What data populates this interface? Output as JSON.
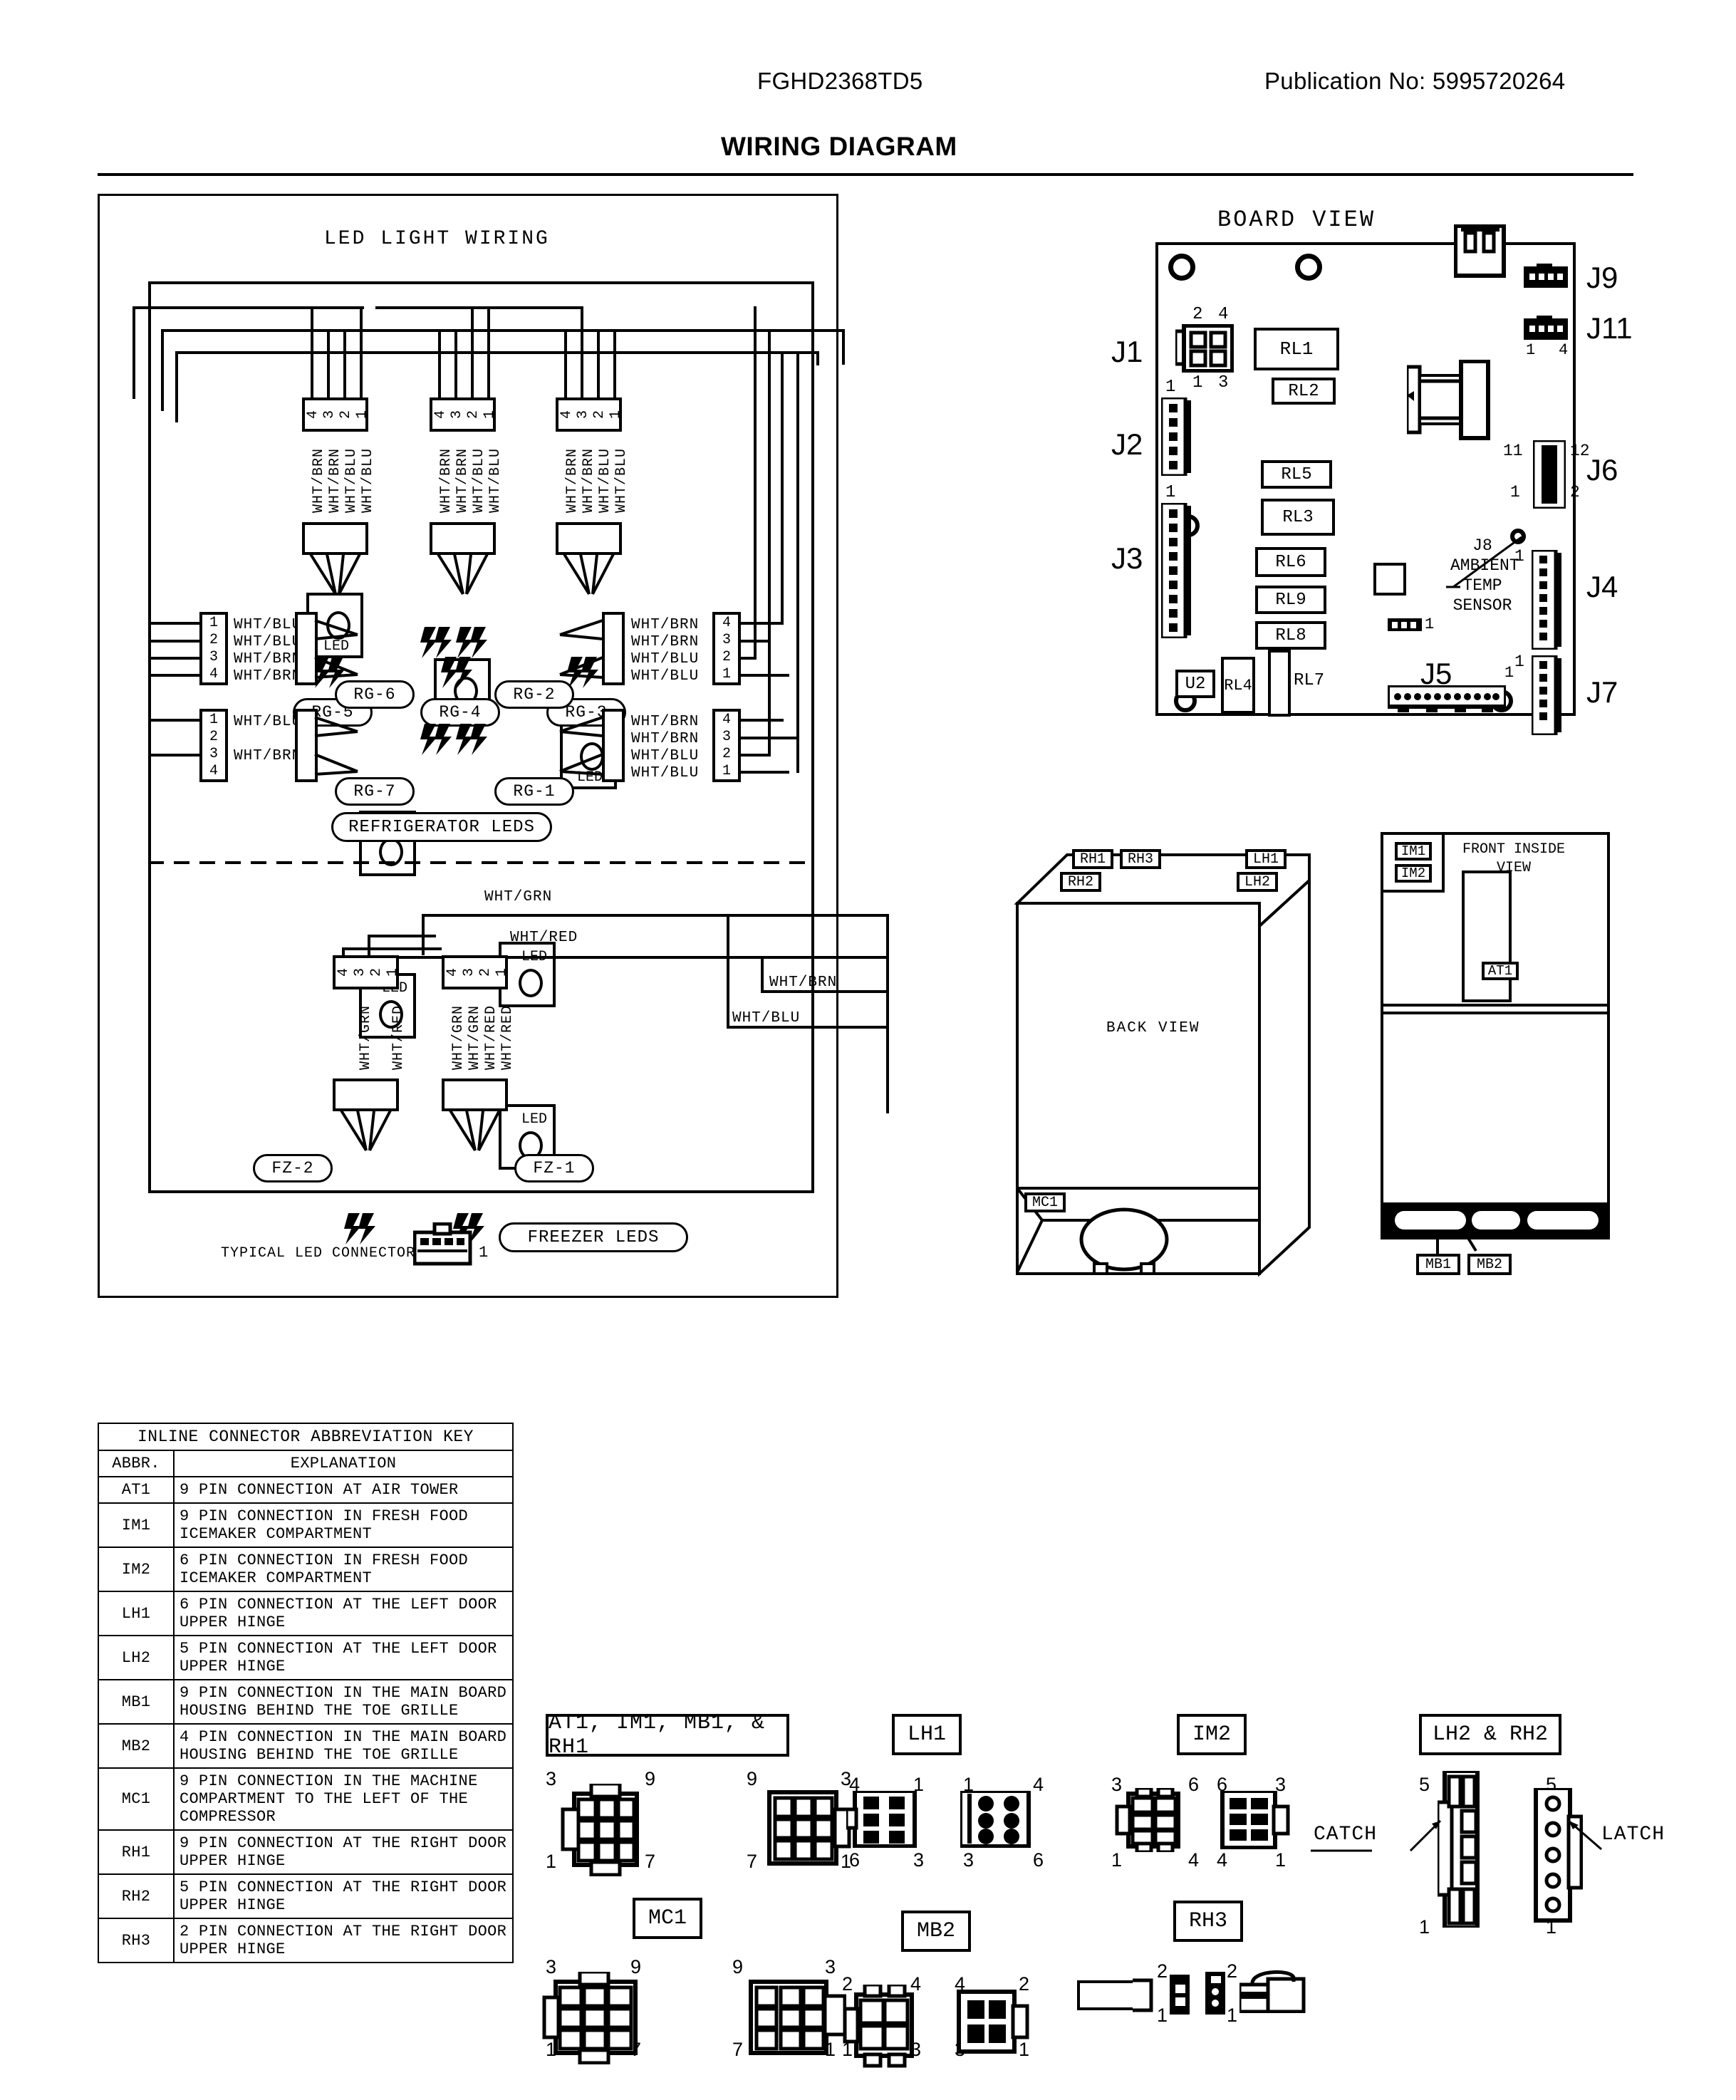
{
  "header": {
    "model": "FGHD2368TD5",
    "publication": "Publication No: 5995720264",
    "title": "WIRING DIAGRAM"
  },
  "led_panel": {
    "title": "LED LIGHT WIRING",
    "refrigerator_group_label": "REFRIGERATOR LEDS",
    "freezer_group_label": "FREEZER LEDS",
    "typical_connector_label": "TYPICAL LED CONNECTOR",
    "typical_connector_pin": "1",
    "top_row": [
      {
        "id": "RG-5",
        "pins": [
          "4",
          "3",
          "2",
          "1"
        ],
        "wires": [
          "WHT/BRN",
          "WHT/BRN",
          "WHT/BLU",
          "WHT/BLU"
        ],
        "led": "LED"
      },
      {
        "id": "RG-4",
        "pins": [
          "4",
          "3",
          "2",
          "1"
        ],
        "wires": [
          "WHT/BRN",
          "WHT/BRN",
          "WHT/BLU",
          "WHT/BLU"
        ],
        "led": "LED"
      },
      {
        "id": "RG-3",
        "pins": [
          "4",
          "3",
          "2",
          "1"
        ],
        "wires": [
          "WHT/BRN",
          "WHT/BRN",
          "WHT/BLU",
          "WHT/BLU"
        ],
        "led": "LED"
      }
    ],
    "mid_left": [
      {
        "id": "RG-6",
        "pins": [
          "1",
          "2",
          "3",
          "4"
        ],
        "wires": [
          "WHT/BLU",
          "WHT/BLU",
          "WHT/BRN",
          "WHT/BRN"
        ],
        "led": "LED"
      },
      {
        "id": "RG-7",
        "pins": [
          "1",
          "2",
          "3",
          "4"
        ],
        "wires": [
          "WHT/BLU",
          "",
          "WHT/BRN",
          ""
        ],
        "led": "LED"
      }
    ],
    "mid_right": [
      {
        "id": "RG-2",
        "pins": [
          "4",
          "3",
          "2",
          "1"
        ],
        "wires": [
          "WHT/BRN",
          "WHT/BRN",
          "WHT/BLU",
          "WHT/BLU"
        ],
        "led": "LED"
      },
      {
        "id": "RG-1",
        "pins": [
          "4",
          "3",
          "2",
          "1"
        ],
        "wires": [
          "WHT/BRN",
          "WHT/BRN",
          "WHT/BLU",
          "WHT/BLU"
        ],
        "led": "LED"
      }
    ],
    "freezer": [
      {
        "id": "FZ-2",
        "pins": [
          "4",
          "3",
          "2",
          "1"
        ],
        "wires": [
          "",
          "WHT/GRN",
          "",
          "WHT/RED"
        ],
        "led": "LED"
      },
      {
        "id": "FZ-1",
        "pins": [
          "4",
          "3",
          "2",
          "1"
        ],
        "wires": [
          "WHT/GRN",
          "WHT/GRN",
          "WHT/RED",
          "WHT/RED"
        ],
        "led": "LED"
      }
    ],
    "harness_labels": {
      "wht_grn": "WHT/GRN",
      "wht_red": "WHT/RED",
      "wht_brn": "WHT/BRN",
      "wht_blu": "WHT/BLU"
    }
  },
  "board": {
    "title": "BOARD VIEW",
    "connectors": [
      "J1",
      "J2",
      "J3",
      "J9",
      "J11",
      "J6",
      "J4",
      "J7",
      "J5"
    ],
    "j1_pins": {
      "top_left": "2",
      "top_right": "4",
      "bottom_left": "1",
      "bottom_right": "3"
    },
    "j2_pin1": "1",
    "j3_pin1": "1",
    "j11_pin_left": "1",
    "j11_pin_right": "4",
    "j6_pins": {
      "tl": "11",
      "tr": "12",
      "bl": "1",
      "br": "2"
    },
    "j4_pin1": "1",
    "j7_pin1": "1",
    "j5_pin1": "1",
    "small_hdr_pin": "1",
    "relays": [
      "RL1",
      "RL2",
      "RL5",
      "RL3",
      "RL6",
      "RL9",
      "RL8",
      "RL4",
      "RL7"
    ],
    "ic": "U2",
    "sensor_label": "J8\nAMBIENT\nTEMP\nSENSOR",
    "sensor_lines": [
      "J8",
      "AMBIENT",
      "TEMP",
      "SENSOR"
    ]
  },
  "back_view": {
    "label": "BACK VIEW",
    "tags": [
      "RH1",
      "RH3",
      "RH2",
      "LH1",
      "LH2",
      "MC1"
    ]
  },
  "front_view": {
    "label_line1": "FRONT INSIDE",
    "label_line2": "VIEW",
    "tags": [
      "IM1",
      "IM2",
      "AT1",
      "MB1",
      "MB2"
    ]
  },
  "key_table": {
    "title": "INLINE CONNECTOR ABBREVIATION KEY",
    "col_abbr": "ABBR.",
    "col_expl": "EXPLANATION",
    "rows": [
      {
        "abbr": "AT1",
        "expl": "9 PIN CONNECTION AT AIR TOWER"
      },
      {
        "abbr": "IM1",
        "expl": "9 PIN CONNECTION IN FRESH FOOD ICEMAKER COMPARTMENT"
      },
      {
        "abbr": "IM2",
        "expl": "6 PIN CONNECTION IN FRESH FOOD ICEMAKER COMPARTMENT"
      },
      {
        "abbr": "LH1",
        "expl": "6 PIN CONNECTION AT THE LEFT DOOR UPPER HINGE"
      },
      {
        "abbr": "LH2",
        "expl": "5 PIN CONNECTION AT THE LEFT DOOR UPPER HINGE"
      },
      {
        "abbr": "MB1",
        "expl": "9 PIN CONNECTION IN THE MAIN BOARD HOUSING BEHIND THE TOE GRILLE"
      },
      {
        "abbr": "MB2",
        "expl": "4 PIN CONNECTION IN THE MAIN BOARD HOUSING BEHIND THE TOE GRILLE"
      },
      {
        "abbr": "MC1",
        "expl": "9 PIN CONNECTION IN THE MACHINE COMPARTMENT TO THE LEFT OF THE COMPRESSOR"
      },
      {
        "abbr": "RH1",
        "expl": "9 PIN CONNECTION AT THE RIGHT DOOR UPPER HINGE"
      },
      {
        "abbr": "RH2",
        "expl": "5 PIN CONNECTION AT THE RIGHT DOOR UPPER HINGE"
      },
      {
        "abbr": "RH3",
        "expl": "2 PIN CONNECTION AT THE RIGHT DOOR UPPER HINGE"
      }
    ]
  },
  "connector_art": {
    "at1_group": {
      "label": "AT1, IM1, MB1, & RH1",
      "left": [
        "3",
        "9",
        "1",
        "7"
      ],
      "right": [
        "9",
        "3",
        "7",
        "1"
      ]
    },
    "lh1": {
      "label": "LH1",
      "left": [
        "4",
        "1",
        "6",
        "3"
      ],
      "right": [
        "1",
        "4",
        "3",
        "6"
      ]
    },
    "im2": {
      "label": "IM2",
      "left": [
        "3",
        "6",
        "1",
        "4"
      ],
      "right": [
        "6",
        "3",
        "4",
        "1"
      ]
    },
    "lh2_rh2": {
      "label": "LH2 & RH2",
      "left_top": "5",
      "left_bottom": "1",
      "right_top": "5",
      "right_bottom": "1",
      "catch": "CATCH",
      "latch": "LATCH"
    },
    "mc1": {
      "label": "MC1",
      "left": [
        "3",
        "9",
        "1",
        "7"
      ],
      "right": [
        "9",
        "3",
        "7",
        "1"
      ]
    },
    "mb2": {
      "label": "MB2",
      "left": [
        "2",
        "4",
        "1",
        "3"
      ],
      "right": [
        "4",
        "2",
        "3",
        "1"
      ]
    },
    "rh3": {
      "label": "RH3",
      "left_top": "2",
      "left_bottom": "1",
      "right_top": "2",
      "right_bottom": "1"
    }
  }
}
